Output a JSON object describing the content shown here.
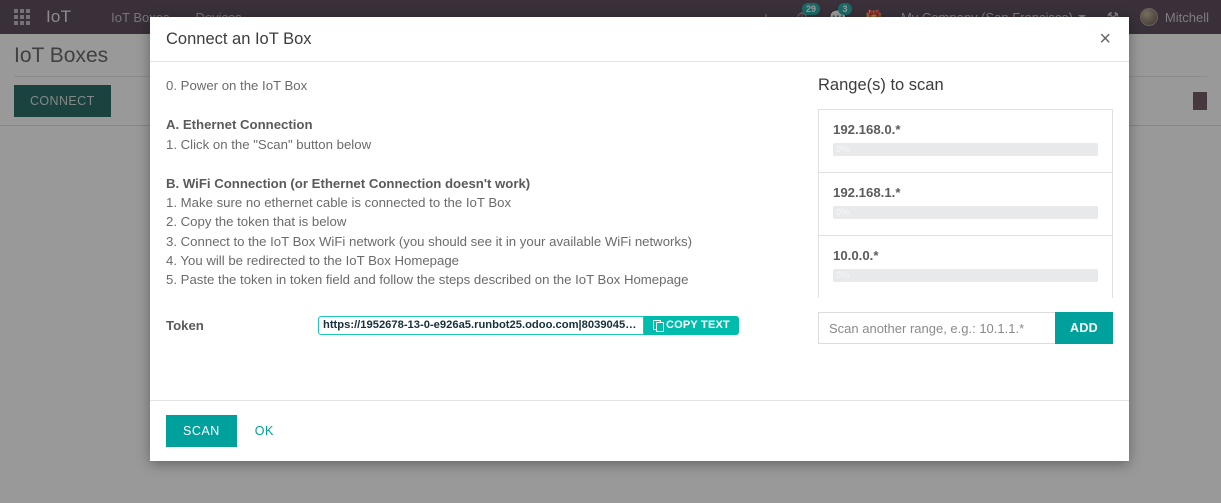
{
  "navbar": {
    "apps_icon": "apps-grid-icon",
    "brand": "IoT",
    "menu": [
      {
        "label": "IoT Boxes"
      },
      {
        "label": "Devices"
      }
    ],
    "right": {
      "plus_icon": "plus-icon",
      "activities_icon": "clock-icon",
      "activities_count": "29",
      "messages_icon": "chat-icon",
      "messages_count": "3",
      "gift_icon": "gift-icon",
      "company": "My Company (San Francisco)",
      "debug_icon": "bug-icon",
      "user_name": "Mitchell"
    }
  },
  "page": {
    "breadcrumb": "IoT Boxes",
    "connect_button": "CONNECT"
  },
  "dialog": {
    "title": "Connect an IoT Box",
    "close_label": "×",
    "intro": "0. Power on the IoT Box",
    "section_a": {
      "heading": "A. Ethernet Connection",
      "steps": [
        "1. Click on the \"Scan\" button below"
      ]
    },
    "section_b": {
      "heading": "B. WiFi Connection (or Ethernet Connection doesn't work)",
      "steps": [
        "1. Make sure no ethernet cable is connected to the IoT Box",
        "2. Copy the token that is below",
        "3. Connect to the IoT Box WiFi network (you should see it in your available WiFi networks)",
        "4. You will be redirected to the IoT Box Homepage",
        "5. Paste the token in token field and follow the steps described on the IoT Box Homepage"
      ]
    },
    "token": {
      "label": "Token",
      "value": "https://1952678-13-0-e926a5.runbot25.odoo.com|80390452…",
      "copy_label": "COPY TEXT",
      "copy_icon": "copy-icon"
    },
    "ranges": {
      "title": "Range(s) to scan",
      "items": [
        {
          "name": "192.168.0.*",
          "progress_label": "0%",
          "progress_value": 0
        },
        {
          "name": "192.168.1.*",
          "progress_label": "0%",
          "progress_value": 0
        },
        {
          "name": "10.0.0.*",
          "progress_label": "0%",
          "progress_value": 0
        }
      ],
      "add_placeholder": "Scan another range, e.g.: 10.1.1.*",
      "add_value": "",
      "add_button": "ADD"
    },
    "footer": {
      "scan_button": "SCAN",
      "ok_button": "OK"
    }
  },
  "colors": {
    "teal": "#00a09d",
    "token_teal": "#00bcad",
    "navbar": "#3f2d3e",
    "connect_green": "#00504a"
  }
}
